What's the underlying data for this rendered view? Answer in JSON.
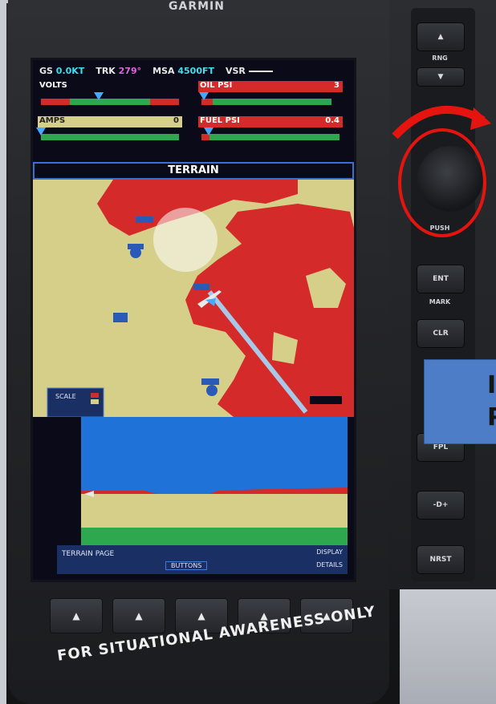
{
  "device": {
    "brand": "GARMIN",
    "caption": "FOR SITUATIONAL AWARENESS ONLY"
  },
  "top_bar": {
    "gs_label": "GS",
    "gs_value": "0.0KT",
    "trk_label": "TRK",
    "trk_value": "279°",
    "msa_label": "MSA",
    "msa_value": "4500FT",
    "vsr_label": "VSR"
  },
  "gauges": {
    "volts": {
      "label": "VOLTS",
      "value": "",
      "level": 0.42
    },
    "oil_psi": {
      "label": "OIL PSI",
      "value": "3",
      "level": 0.02
    },
    "amps": {
      "label": "AMPS",
      "value": "0",
      "level": 0.0
    },
    "fuel_psi": {
      "label": "FUEL PSI",
      "value": "0.4",
      "level": 0.05
    }
  },
  "page_title": "TERRAIN",
  "map": {
    "scale_label": "SCALE"
  },
  "status_bar": {
    "page_name": "TERRAIN PAGE",
    "option": "BUTTONS",
    "right_tag": "DISPLAY",
    "right_tag2": "DETAILS"
  },
  "softkeys": [
    "▲",
    "▲",
    "▲",
    "▲",
    "▲"
  ],
  "right_keys": {
    "rng_label": "RNG",
    "push_label": "PUSH",
    "enter_label": "ENT",
    "mark_label": "MARK",
    "clear_label": "CLR",
    "fpl_label": "FPL",
    "direct_label": "-D+",
    "nrst_label": "NRST"
  },
  "overlay": {
    "line1": "I",
    "line2": "P"
  },
  "colors": {
    "terrain_red": "#d42a2a",
    "terrain_yellow": "#d6cf8a",
    "sky_blue": "#1f73d8",
    "highlight_ring": "#e5140f",
    "info_box": "#4d7dc6"
  }
}
